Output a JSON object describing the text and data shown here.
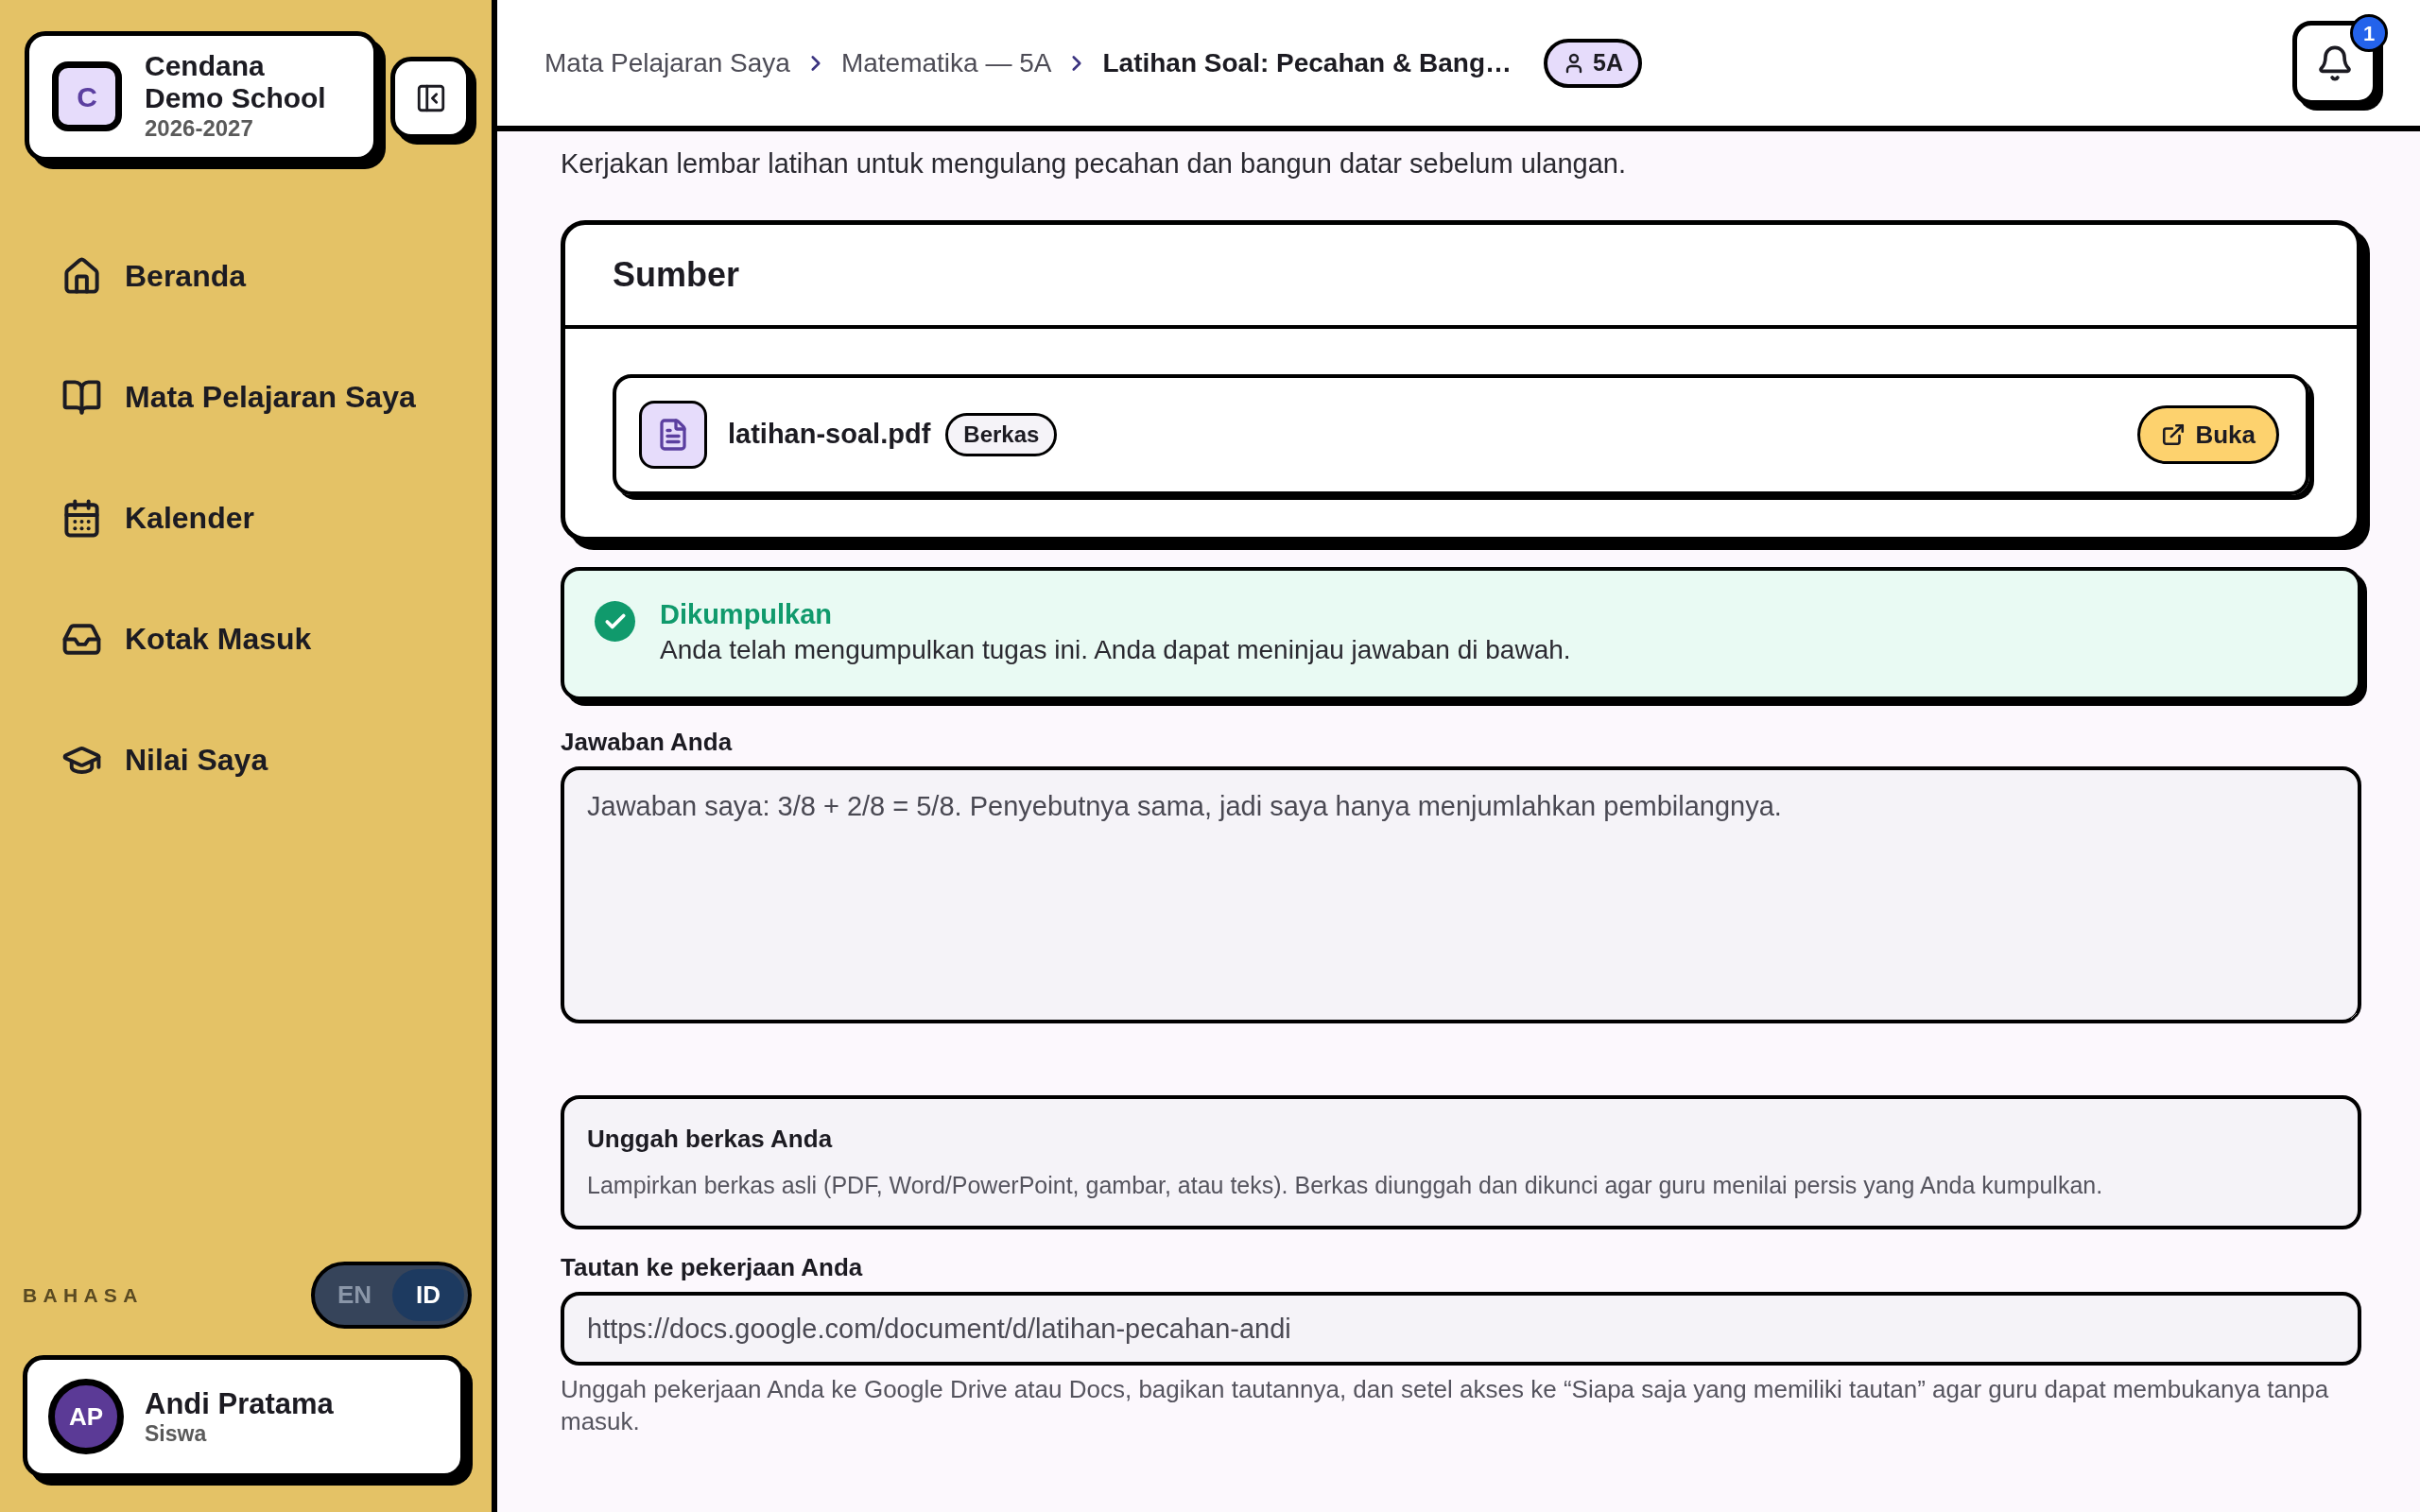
{
  "sidebar": {
    "school": {
      "initial": "C",
      "name": "Cendana Demo School",
      "year": "2026-2027"
    },
    "nav_items": [
      {
        "label": "Beranda",
        "kind": "home"
      },
      {
        "label": "Mata Pelajaran Saya",
        "kind": "book"
      },
      {
        "label": "Kalender",
        "kind": "calendar"
      },
      {
        "label": "Kotak Masuk",
        "kind": "inbox"
      },
      {
        "label": "Nilai Saya",
        "kind": "grades"
      }
    ],
    "language": {
      "label": "BAHASA",
      "options": [
        {
          "label": "EN",
          "selected": false
        },
        {
          "label": "ID",
          "selected": true
        }
      ]
    },
    "user": {
      "initials": "AP",
      "name": "Andi Pratama",
      "role": "Siswa"
    }
  },
  "header": {
    "breadcrumb": [
      {
        "label": "Mata Pelajaran Saya",
        "current": false
      },
      {
        "label": "Matematika — 5A",
        "current": false
      },
      {
        "label": "Latihan Soal: Pecahan & Bang…",
        "current": true
      }
    ],
    "class_badge": "5A",
    "notifications": "1"
  },
  "description": "Kerjakan lembar latihan untuk mengulang pecahan dan bangun datar sebelum ulangan.",
  "resources": {
    "title": "Sumber",
    "files": [
      {
        "name": "latihan-soal.pdf",
        "tag": "Berkas",
        "action": "Buka"
      }
    ]
  },
  "status": {
    "kind": "submitted",
    "title": "Dikumpulkan",
    "message": "Anda telah mengumpulkan tugas ini. Anda dapat meninjau jawaban di bawah."
  },
  "answer": {
    "label": "Jawaban Anda",
    "value": "Jawaban saya: 3/8 + 2/8 = 5/8. Penyebutnya sama, jadi saya hanya menjumlahkan pembilangnya."
  },
  "upload": {
    "title": "Unggah berkas Anda",
    "description": "Lampirkan berkas asli (PDF, Word/PowerPoint, gambar, atau teks). Berkas diunggah dan dikunci agar guru menilai persis yang Anda kumpulkan."
  },
  "link": {
    "label": "Tautan ke pekerjaan Anda",
    "value": "https://docs.google.com/document/d/latihan-pecahan-andi",
    "help": "Unggah pekerjaan Anda ke Google Drive atau Docs, bagikan tautannya, dan setel akses ke “Siapa saja yang memiliki tautan” agar guru dapat membukanya tanpa masuk."
  }
}
